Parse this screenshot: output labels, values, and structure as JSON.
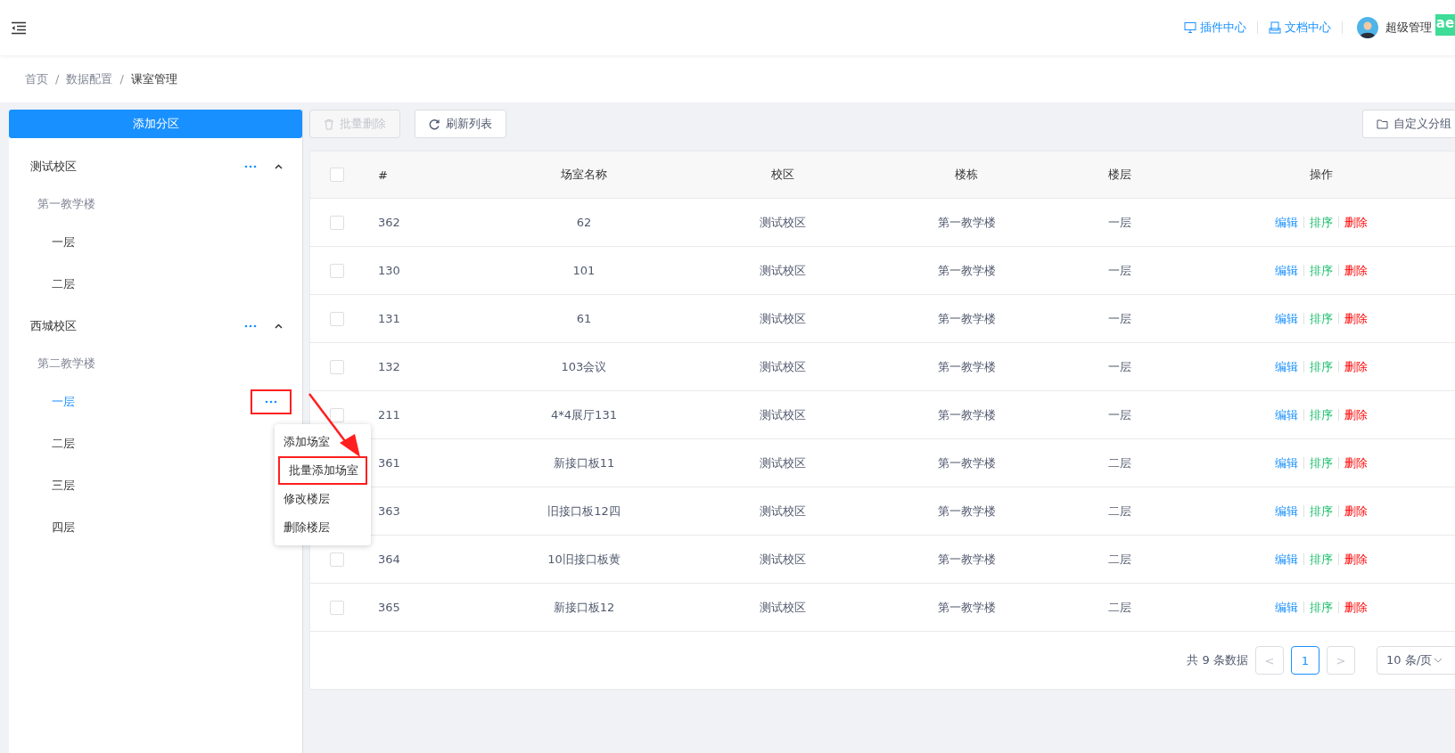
{
  "header": {
    "links": [
      {
        "label": "插件中心"
      },
      {
        "label": "文档中心"
      }
    ],
    "user": {
      "name": "超级管理"
    },
    "extension_badge": "ae"
  },
  "breadcrumb": [
    {
      "kind": "link",
      "label": "首页"
    },
    {
      "kind": "separator",
      "label": "/"
    },
    {
      "kind": "link",
      "label": "数据配置"
    },
    {
      "kind": "separator",
      "label": "/"
    },
    {
      "kind": "current",
      "label": "课室管理"
    }
  ],
  "sidebar": {
    "add_button": "添加分区",
    "tree": [
      {
        "label": "测试校区",
        "expanded": true,
        "children": [
          {
            "label": "第一教学楼",
            "children": [
              {
                "label": "一层",
                "selected": false,
                "menu_open": false
              },
              {
                "label": "二层",
                "selected": false,
                "menu_open": false
              }
            ]
          }
        ]
      },
      {
        "label": "西城校区",
        "expanded": true,
        "children": [
          {
            "label": "第二教学楼",
            "children": [
              {
                "label": "一层",
                "selected": true,
                "menu_open": true
              },
              {
                "label": "二层",
                "selected": false,
                "menu_open": false
              },
              {
                "label": "三层",
                "selected": false,
                "menu_open": false
              },
              {
                "label": "四层",
                "selected": false,
                "menu_open": false
              }
            ]
          }
        ]
      }
    ]
  },
  "floor_menu": {
    "items": [
      {
        "label": "添加场室",
        "highlighted": false
      },
      {
        "label": "批量添加场室",
        "highlighted": true
      },
      {
        "label": "修改楼层",
        "highlighted": false
      },
      {
        "label": "删除楼层",
        "highlighted": false
      }
    ]
  },
  "toolbar": {
    "buttons": [
      {
        "label": "批量删除",
        "disabled": true
      },
      {
        "label": "刷新列表",
        "disabled": false
      }
    ],
    "custom_group": "自定义分组"
  },
  "table": {
    "columns": [
      "#",
      "场室名称",
      "校区",
      "楼栋",
      "楼层",
      "操作"
    ],
    "header_checked": false,
    "rows": [
      {
        "checked": false,
        "cells": [
          "362",
          "62",
          "测试校区",
          "第一教学楼",
          "一层"
        ],
        "actions": [
          {
            "kind": "edit",
            "label": "编辑"
          },
          {
            "kind": "sort",
            "label": "排序"
          },
          {
            "kind": "delete",
            "label": "删除"
          }
        ]
      },
      {
        "checked": false,
        "cells": [
          "130",
          "101",
          "测试校区",
          "第一教学楼",
          "一层"
        ],
        "actions": [
          {
            "kind": "edit",
            "label": "编辑"
          },
          {
            "kind": "sort",
            "label": "排序"
          },
          {
            "kind": "delete",
            "label": "删除"
          }
        ]
      },
      {
        "checked": false,
        "cells": [
          "131",
          "61",
          "测试校区",
          "第一教学楼",
          "一层"
        ],
        "actions": [
          {
            "kind": "edit",
            "label": "编辑"
          },
          {
            "kind": "sort",
            "label": "排序"
          },
          {
            "kind": "delete",
            "label": "删除"
          }
        ]
      },
      {
        "checked": false,
        "cells": [
          "132",
          "103会议",
          "测试校区",
          "第一教学楼",
          "一层"
        ],
        "actions": [
          {
            "kind": "edit",
            "label": "编辑"
          },
          {
            "kind": "sort",
            "label": "排序"
          },
          {
            "kind": "delete",
            "label": "删除"
          }
        ]
      },
      {
        "checked": false,
        "cells": [
          "211",
          "4*4展厅131",
          "测试校区",
          "第一教学楼",
          "一层"
        ],
        "actions": [
          {
            "kind": "edit",
            "label": "编辑"
          },
          {
            "kind": "sort",
            "label": "排序"
          },
          {
            "kind": "delete",
            "label": "删除"
          }
        ]
      },
      {
        "cells": [
          "361",
          "新接口板11",
          "测试校区",
          "第一教学楼",
          "二层"
        ],
        "actions": [
          {
            "kind": "edit",
            "label": "编辑"
          },
          {
            "kind": "sort",
            "label": "排序"
          },
          {
            "kind": "delete",
            "label": "删除"
          }
        ]
      },
      {
        "cells": [
          "363",
          "旧接口板12四",
          "测试校区",
          "第一教学楼",
          "二层"
        ],
        "actions": [
          {
            "kind": "edit",
            "label": "编辑"
          },
          {
            "kind": "sort",
            "label": "排序"
          },
          {
            "kind": "delete",
            "label": "删除"
          }
        ]
      },
      {
        "checked": false,
        "cells": [
          "364",
          "10旧接口板黄",
          "测试校区",
          "第一教学楼",
          "二层"
        ],
        "actions": [
          {
            "kind": "edit",
            "label": "编辑"
          },
          {
            "kind": "sort",
            "label": "排序"
          },
          {
            "kind": "delete",
            "label": "删除"
          }
        ]
      },
      {
        "checked": false,
        "cells": [
          "365",
          "新接口板12",
          "测试校区",
          "第一教学楼",
          "二层"
        ],
        "actions": [
          {
            "kind": "edit",
            "label": "编辑"
          },
          {
            "kind": "sort",
            "label": "排序"
          },
          {
            "kind": "delete",
            "label": "删除"
          }
        ]
      }
    ]
  },
  "pagination": {
    "total": "共 9 条数据",
    "prev": "<",
    "next": ">",
    "pages": [
      {
        "label": "1",
        "selected": true
      }
    ],
    "page_size": "10 条/页"
  }
}
